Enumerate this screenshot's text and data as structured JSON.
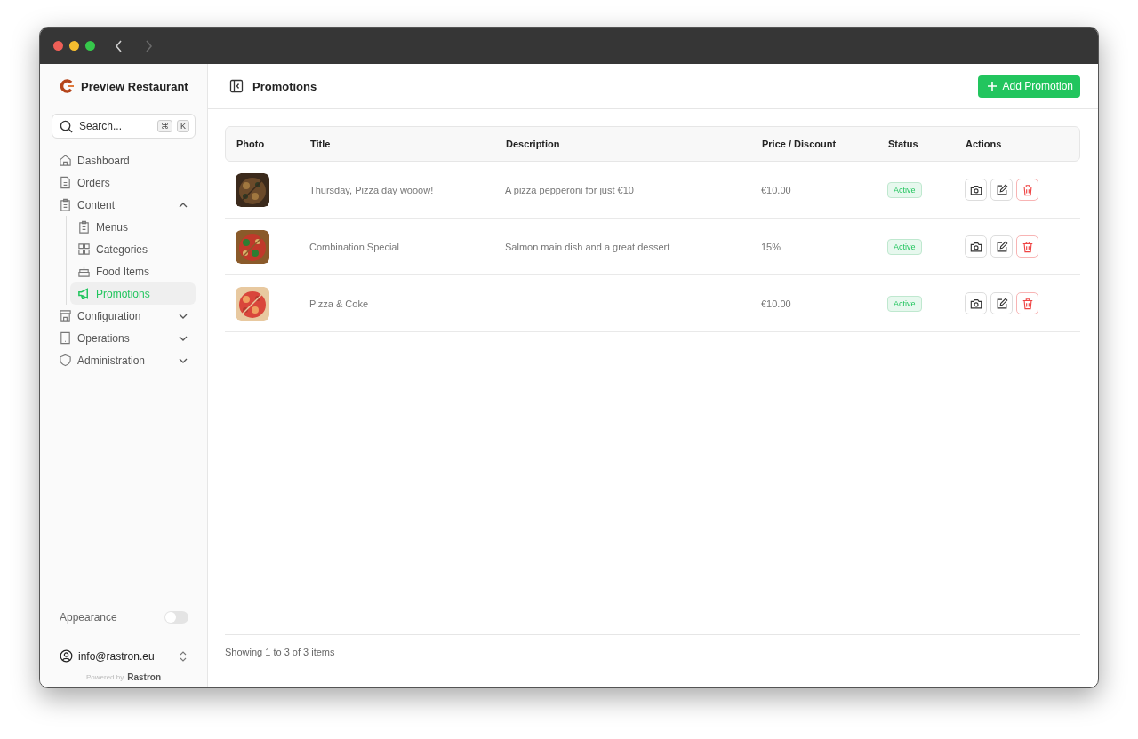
{
  "sidebar": {
    "brand": "Preview Restaurant",
    "search": {
      "placeholder": "Search...",
      "shortcut": [
        "⌘",
        "K"
      ]
    },
    "items": [
      {
        "label": "Dashboard",
        "selected": false
      },
      {
        "label": "Orders",
        "selected": false
      },
      {
        "label": "Content",
        "selected": false,
        "expanded": true,
        "children": [
          {
            "label": "Menus",
            "selected": false
          },
          {
            "label": "Categories",
            "selected": false
          },
          {
            "label": "Food Items",
            "selected": false
          },
          {
            "label": "Promotions",
            "selected": true
          }
        ]
      },
      {
        "label": "Configuration",
        "selected": false,
        "expanded": false
      },
      {
        "label": "Operations",
        "selected": false,
        "expanded": false
      },
      {
        "label": "Administration",
        "selected": false,
        "expanded": false
      }
    ],
    "appearance": {
      "label": "Appearance",
      "on": false
    },
    "user": "info@rastron.eu",
    "powered_by": "Powered by",
    "powered_brand": "Rastron"
  },
  "header": {
    "title": "Promotions",
    "add_button": "Add Promotion"
  },
  "table": {
    "columns": [
      "Photo",
      "Title",
      "Description",
      "Price / Discount",
      "Status",
      "Actions"
    ],
    "rows": [
      {
        "title": "Thursday, Pizza day wooow!",
        "description": "A pizza pepperoni for just €10",
        "price": "€10.00",
        "status": "Active"
      },
      {
        "title": "Combination Special",
        "description": "Salmon main dish and a great dessert",
        "price": "15%",
        "status": "Active"
      },
      {
        "title": "Pizza & Coke",
        "price": "€10.00",
        "status": "Active"
      }
    ]
  },
  "footer": "Showing 1 to 3 of 3 items"
}
